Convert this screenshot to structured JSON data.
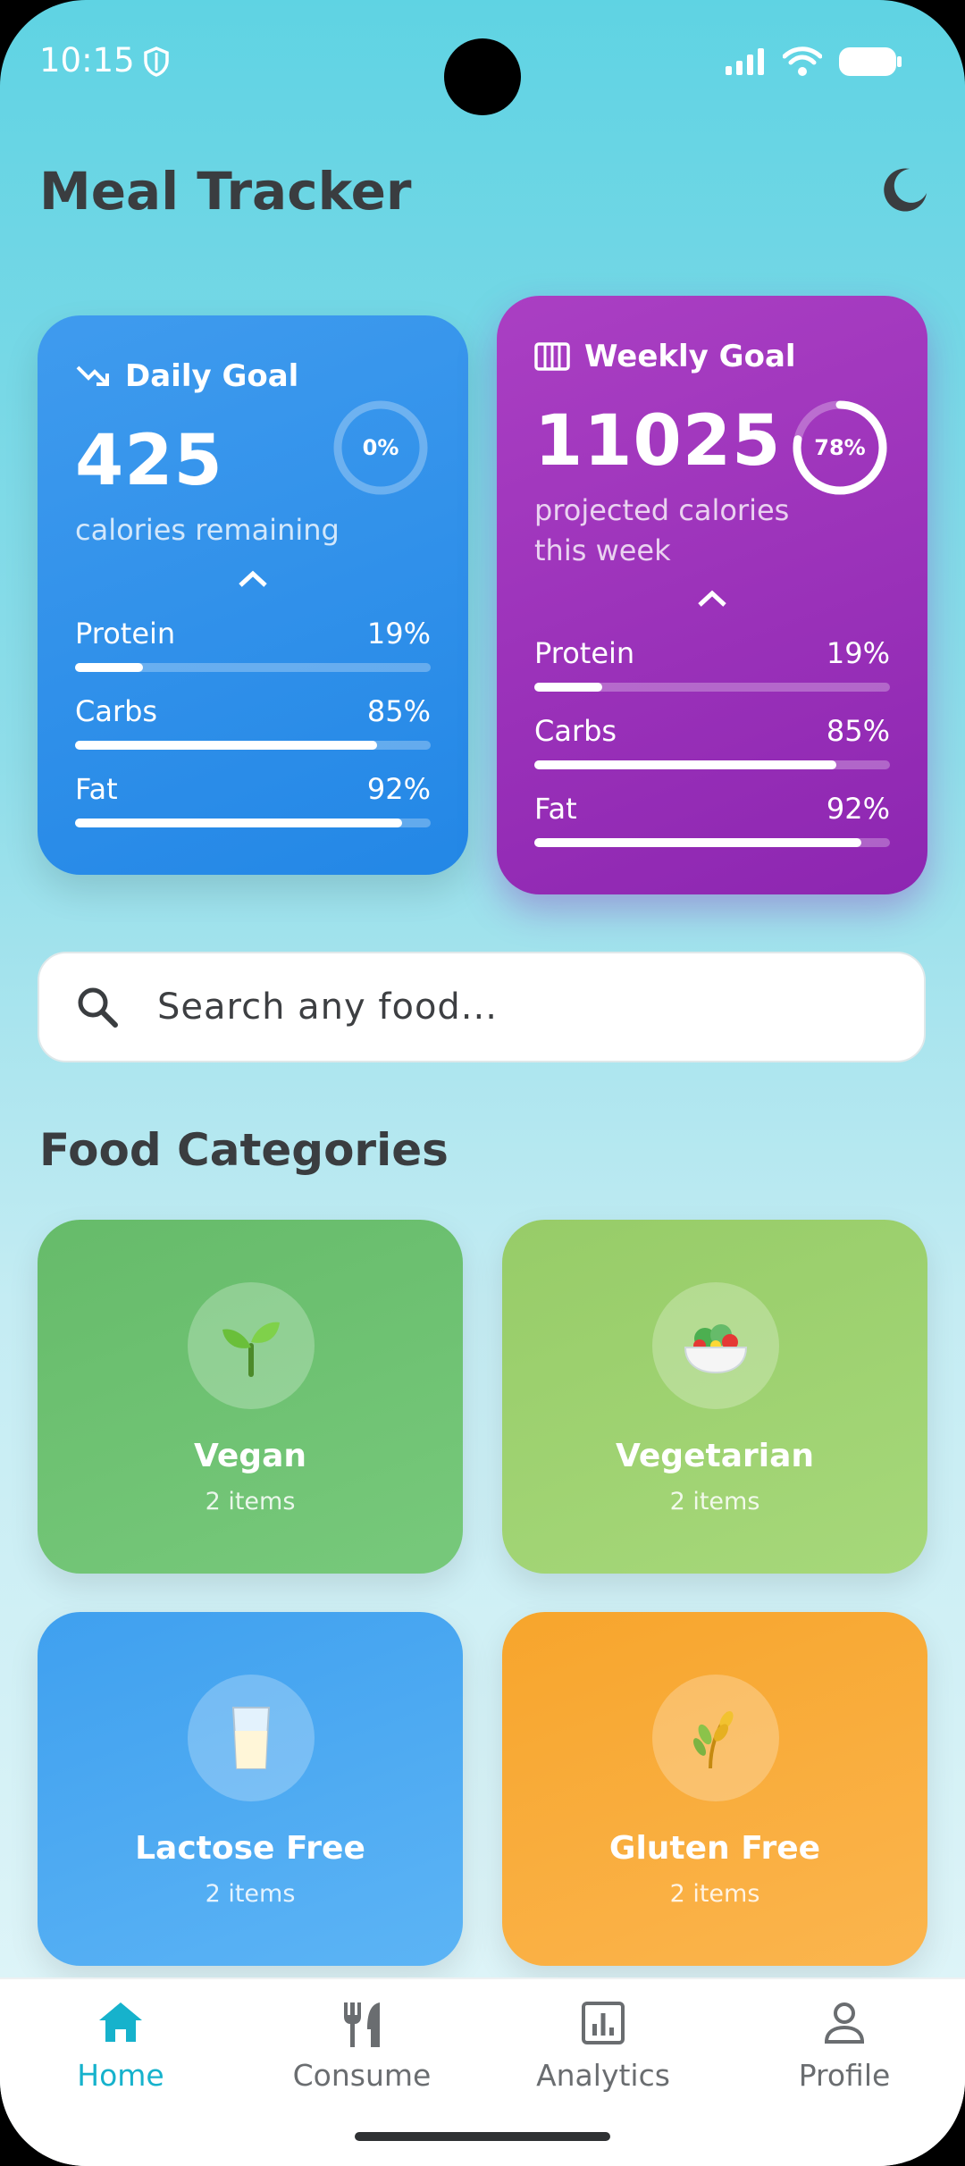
{
  "status_bar": {
    "time": "10:15"
  },
  "app": {
    "title": "Meal Tracker"
  },
  "daily_goal": {
    "title": "Daily Goal",
    "value": "425",
    "subtitle": "calories remaining",
    "progress_percent": 0,
    "progress_label": "0%",
    "macros": [
      {
        "name": "Protein",
        "percent_label": "19%",
        "value": 0.19
      },
      {
        "name": "Carbs",
        "percent_label": "85%",
        "value": 0.85
      },
      {
        "name": "Fat",
        "percent_label": "92%",
        "value": 0.92
      }
    ]
  },
  "weekly_goal": {
    "title": "Weekly Goal",
    "value": "11025",
    "subtitle_line1": "projected calories",
    "subtitle_line2": "this week",
    "progress_percent": 78,
    "progress_label": "78%",
    "macros": [
      {
        "name": "Protein",
        "percent_label": "19%",
        "value": 0.19
      },
      {
        "name": "Carbs",
        "percent_label": "85%",
        "value": 0.85
      },
      {
        "name": "Fat",
        "percent_label": "92%",
        "value": 0.92
      }
    ]
  },
  "search": {
    "placeholder": "Search any food..."
  },
  "categories_section": {
    "title": "Food Categories"
  },
  "categories": [
    {
      "name": "Vegan",
      "count": "2 items",
      "icon": "seedling-icon",
      "emoji": "🌱",
      "color": "#66bb6a"
    },
    {
      "name": "Vegetarian",
      "count": "2 items",
      "icon": "salad-icon",
      "emoji": "🥗",
      "color": "#9ccc65"
    },
    {
      "name": "Lactose Free",
      "count": "2 items",
      "icon": "milk-glass-icon",
      "emoji": "🥛",
      "color": "#42a5f5"
    },
    {
      "name": "Gluten Free",
      "count": "2 items",
      "icon": "wheat-icon",
      "emoji": "🌾",
      "color": "#ffa726"
    }
  ],
  "nav": {
    "items": [
      {
        "label": "Home",
        "active": true
      },
      {
        "label": "Consume",
        "active": false
      },
      {
        "label": "Analytics",
        "active": false
      },
      {
        "label": "Profile",
        "active": false
      }
    ]
  },
  "colors": {
    "accent": "#16b2cc",
    "daily_card": "#2a8ce8",
    "weekly_card": "#9a2fba"
  }
}
